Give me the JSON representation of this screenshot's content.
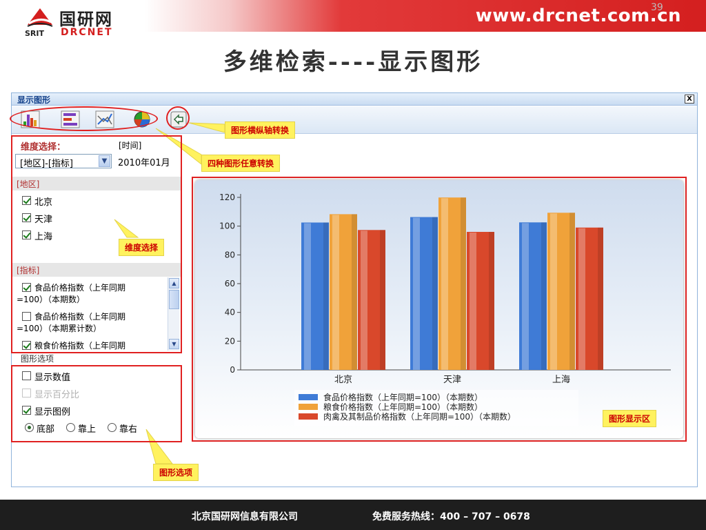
{
  "header": {
    "logo_cn": "国研网",
    "logo_srit": "SRIT",
    "logo_drcnet": "DRCNET",
    "site_url": "www.drcnet.com.cn"
  },
  "slide_title": "多维检索----显示图形",
  "window": {
    "title": "显示图形",
    "close_label": "X",
    "toolbar_icons": [
      "bar-chart-icon",
      "horizontal-bar-chart-icon",
      "line-chart-icon",
      "pie-chart-icon",
      "axis-swap-icon"
    ]
  },
  "dimension": {
    "label": "维度选择：",
    "time_label": "[时间]",
    "dim_select_value": "[地区]-[指标]",
    "time_value": "2010年01月"
  },
  "region": {
    "header": "[地区]",
    "items": [
      {
        "label": "北京",
        "checked": true
      },
      {
        "label": "天津",
        "checked": true
      },
      {
        "label": "上海",
        "checked": true
      }
    ]
  },
  "indicator": {
    "header": "[指标]",
    "items": [
      {
        "line1": "食品价格指数（上年同期",
        "line2": "=100）（本期数）",
        "checked": true
      },
      {
        "line1": "食品价格指数（上年同期",
        "line2": "=100）（本期累计数）",
        "checked": false
      },
      {
        "line1": "粮食价格指数（上年同期",
        "checked": true
      }
    ]
  },
  "options": {
    "header": "图形选项",
    "show_values": "显示数值",
    "show_percent": "显示百分比",
    "show_legend": "显示图例",
    "pos_bottom": "底部",
    "pos_top": "靠上",
    "pos_right": "靠右"
  },
  "callouts": {
    "axis_swap": "图形横纵轴转换",
    "four_types": "四种图形任意转换",
    "dim_select": "维度选择",
    "chart_area": "图形显示区",
    "chart_options": "图形选项"
  },
  "colors": {
    "series": [
      "#3f7bd6",
      "#f0a23a",
      "#d9482b"
    ],
    "accent": "#e02020"
  },
  "chart_data": {
    "type": "bar",
    "categories": [
      "北京",
      "天津",
      "上海"
    ],
    "series": [
      {
        "name": "食品价格指数（上年同期=100）（本期数）",
        "values": [
          102.5,
          106.3,
          102.6
        ]
      },
      {
        "name": "粮食价格指数（上年同期=100）（本期数）",
        "values": [
          108.3,
          119.9,
          109.3
        ]
      },
      {
        "name": "肉禽及其制品价格指数（上年同期=100）（本期数）",
        "values": [
          97.3,
          96.0,
          99.0
        ]
      }
    ],
    "yticks": [
      0,
      20,
      40,
      60,
      80,
      100,
      120
    ],
    "ylim": [
      0,
      120
    ],
    "legend_position": "bottom",
    "grid": false
  },
  "footer": {
    "company": "北京国研网信息有限公司",
    "hotline": "免费服务热线：400 – 707 – 0678",
    "slide_number": "39"
  }
}
